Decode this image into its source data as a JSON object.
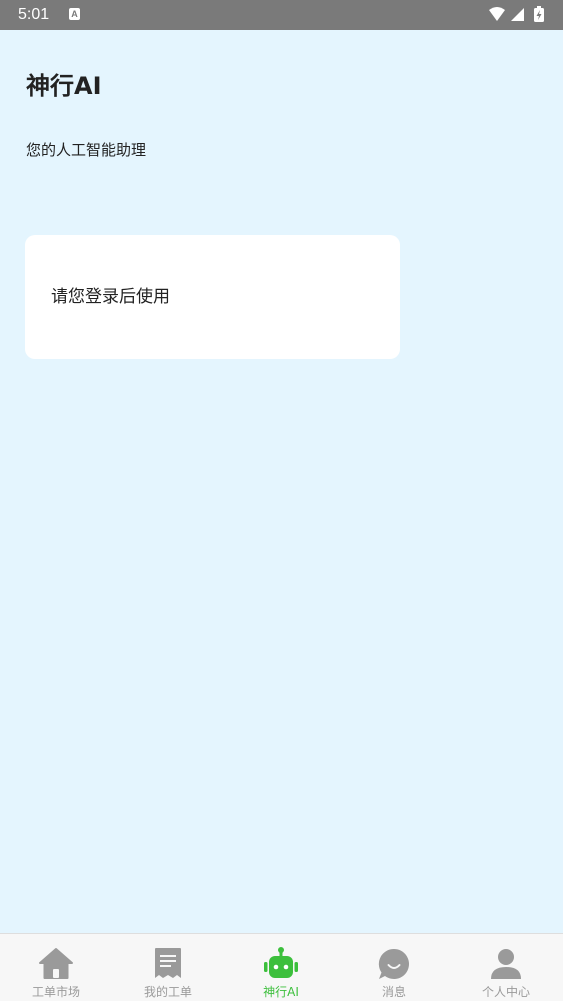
{
  "status_bar": {
    "time": "5:01",
    "keyboard_badge": "A",
    "icons": [
      "wifi-icon",
      "signal-icon",
      "battery-charging-icon"
    ]
  },
  "page": {
    "title": "神行AI",
    "subtitle": "您的人工智能助理"
  },
  "login_card": {
    "message": "请您登录后使用"
  },
  "tab_bar": {
    "active_color": "#3cbf3c",
    "inactive_color": "#9a9a9a",
    "tabs": [
      {
        "label": "工单市场",
        "icon": "home-icon",
        "active": false
      },
      {
        "label": "我的工单",
        "icon": "document-icon",
        "active": false
      },
      {
        "label": "神行AI",
        "icon": "robot-icon",
        "active": true
      },
      {
        "label": "消息",
        "icon": "chat-bubble-icon",
        "active": false
      },
      {
        "label": "个人中心",
        "icon": "user-icon",
        "active": false
      }
    ]
  },
  "colors": {
    "background": "#e4f5fe",
    "status_bar": "#7a7a7a",
    "card": "#ffffff"
  }
}
